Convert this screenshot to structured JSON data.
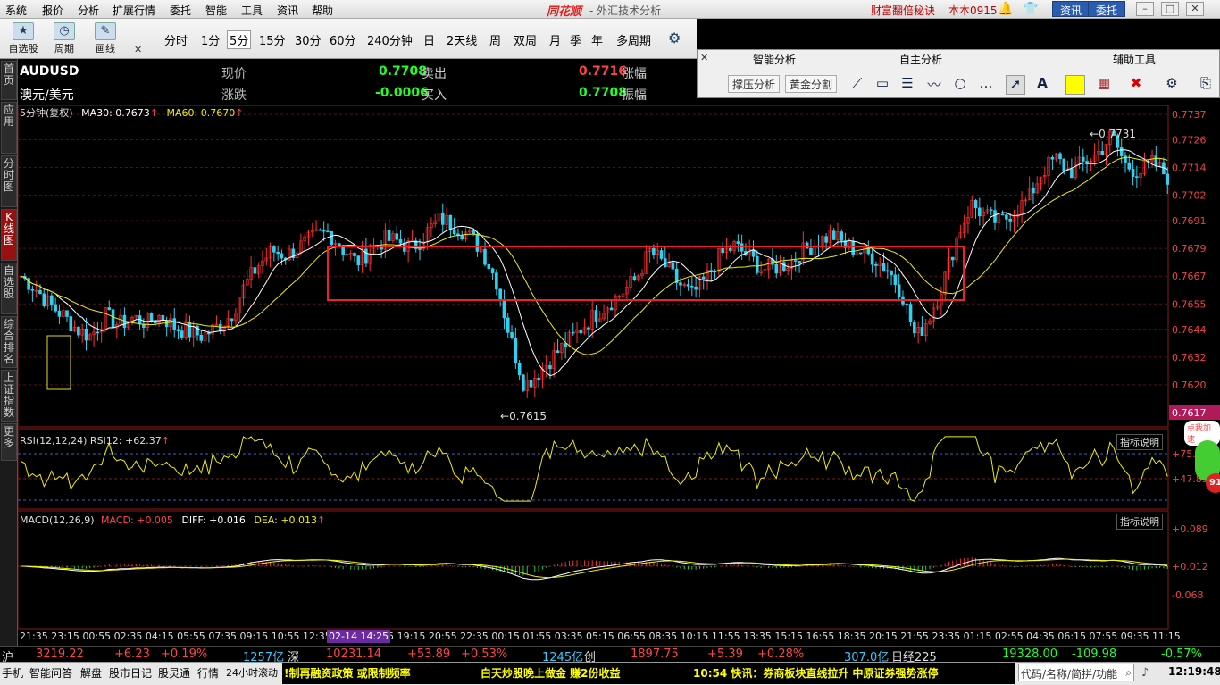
{
  "menu": [
    "系统",
    "报价",
    "分析",
    "扩展行情",
    "委托",
    "智能",
    "工具",
    "资讯",
    "帮助"
  ],
  "app_brand": "同花顺",
  "app_subtitle": "- 外汇技术分析",
  "promo1": "财富翻倍秘诀",
  "promo2": "本本0915",
  "btn_news": "资讯",
  "btn_trade": "委托",
  "toolbar": {
    "big_buttons": [
      "自选股",
      "周期",
      "画线"
    ],
    "periods": [
      "分时",
      "1分",
      "5分",
      "15分",
      "30分",
      "60分",
      "240分钟",
      "日",
      "2天线",
      "周",
      "双周",
      "月",
      "季",
      "年",
      "多周期"
    ],
    "selected_period": "5分"
  },
  "tool_panel": {
    "h1": "智能分析",
    "h2": "自主分析",
    "h3": "辅助工具",
    "b1": "撑压分析",
    "b2": "黄金分割"
  },
  "left_tabs": [
    "首页",
    "应用",
    "分时图",
    "K线图",
    "自选股",
    "综合排名",
    "上证指数",
    "更多"
  ],
  "quote": {
    "symbol": "AUDUSD",
    "name": "澳元/美元",
    "l_price": "现价",
    "price": "0.7708",
    "l_sell": "卖出",
    "sell": "0.7716",
    "l_rise": "涨幅",
    "l_change": "涨跌",
    "change": "-0.0006",
    "l_buy": "买入",
    "buy": "0.7708",
    "l_amp": "振幅"
  },
  "chart_data": {
    "type": "candlestick",
    "title": "5分钟(复权)",
    "ma30": "MA30: 0.7673",
    "ma60": "MA60: 0.7670",
    "ylim": [
      0.7608,
      0.7737
    ],
    "y_ticks": [
      "0.7737",
      "0.7726",
      "0.7714",
      "0.7702",
      "0.7691",
      "0.7679",
      "0.7667",
      "0.7655",
      "0.7644",
      "0.7632",
      "0.7620"
    ],
    "last_price_tag": "0.7617",
    "high_mark": "0.7731",
    "low_mark": "0.7615",
    "close_path": [
      0.7667,
      0.7662,
      0.7655,
      0.765,
      0.7644,
      0.7641,
      0.765,
      0.7646,
      0.7649,
      0.7647,
      0.765,
      0.7645,
      0.7643,
      0.7641,
      0.7645,
      0.765,
      0.7663,
      0.7672,
      0.7678,
      0.7676,
      0.768,
      0.7684,
      0.7686,
      0.7679,
      0.7673,
      0.7678,
      0.7683,
      0.7682,
      0.7679,
      0.7686,
      0.7692,
      0.7689,
      0.7685,
      0.7678,
      0.7665,
      0.764,
      0.762,
      0.7625,
      0.7632,
      0.7638,
      0.7644,
      0.765,
      0.7655,
      0.766,
      0.7666,
      0.7678,
      0.7672,
      0.7664,
      0.7659,
      0.7666,
      0.7676,
      0.768,
      0.7676,
      0.767,
      0.7671,
      0.7673,
      0.7678,
      0.7682,
      0.7685,
      0.768,
      0.7678,
      0.7675,
      0.767,
      0.766,
      0.764,
      0.765,
      0.7665,
      0.7685,
      0.7698,
      0.7693,
      0.769,
      0.7695,
      0.77,
      0.7712,
      0.7718,
      0.7712,
      0.7716,
      0.772,
      0.7728,
      0.7715,
      0.7712,
      0.7716,
      0.771
    ],
    "x_ticks": [
      "21:35",
      "23:15",
      "00:55",
      "02:35",
      "04:15",
      "05:55",
      "07:35",
      "09:15",
      "10:55",
      "12:35",
      "14:25",
      "17:35",
      "19:15",
      "20:55",
      "22:35",
      "00:15",
      "01:55",
      "03:35",
      "05:15",
      "06:55",
      "08:35",
      "10:15",
      "11:55",
      "13:35",
      "15:15",
      "16:55",
      "18:35",
      "20:15",
      "21:55",
      "23:35",
      "01:15",
      "02:55",
      "04:35",
      "06:15",
      "07:55",
      "09:35",
      "11:15"
    ],
    "x_highlight": "02-14 14:25",
    "rsi_label": "RSI(12,12,24) RSI12: +62.37",
    "rsi_ticks": [
      "+75.91",
      "+47.89"
    ],
    "macd_label_a": "MACD(12,26,9)",
    "macd_label_b": "MACD: +0.005",
    "macd_label_c": "DIFF: +0.016",
    "macd_label_d": "DEA: +0.013",
    "macd_ticks": [
      "+0.089",
      "+0.012",
      "-0.068"
    ],
    "indicator_help": "指标说明",
    "float_badge": "点我加速",
    "float_num": "91"
  },
  "status1": {
    "sh_label": "沪",
    "sh_val": "3219.22",
    "sh_chg": "+6.23",
    "sh_pct": "+0.19%",
    "sh_amt": "1257亿",
    "sz_label": "深",
    "sz_val": "10231.14",
    "sz_chg": "+53.89",
    "sz_pct": "+0.53%",
    "sz_amt": "1245亿",
    "cy_label": "创",
    "cy_val": "1897.75",
    "cy_chg": "+5.39",
    "cy_pct": "+0.28%",
    "cy_amt": "307.0亿",
    "nk_label": "日经225",
    "nk_val": "19328.00",
    "nk_chg": "-109.98",
    "nk_pct": "-0.57%"
  },
  "status2": {
    "items": [
      "手机",
      "智能问答",
      "解盘",
      "股市日记",
      "股灵通",
      "行情",
      "24小时滚动"
    ],
    "news1": "!制再融资政策 或限制频率",
    "news2": "白天炒股晚上做金 赚2份收益",
    "news3": "10:54 快讯：券商板块直线拉升 中原证券强势涨停",
    "search_hint": "代码/名称/简拼/功能",
    "clock": "12:19:48"
  }
}
